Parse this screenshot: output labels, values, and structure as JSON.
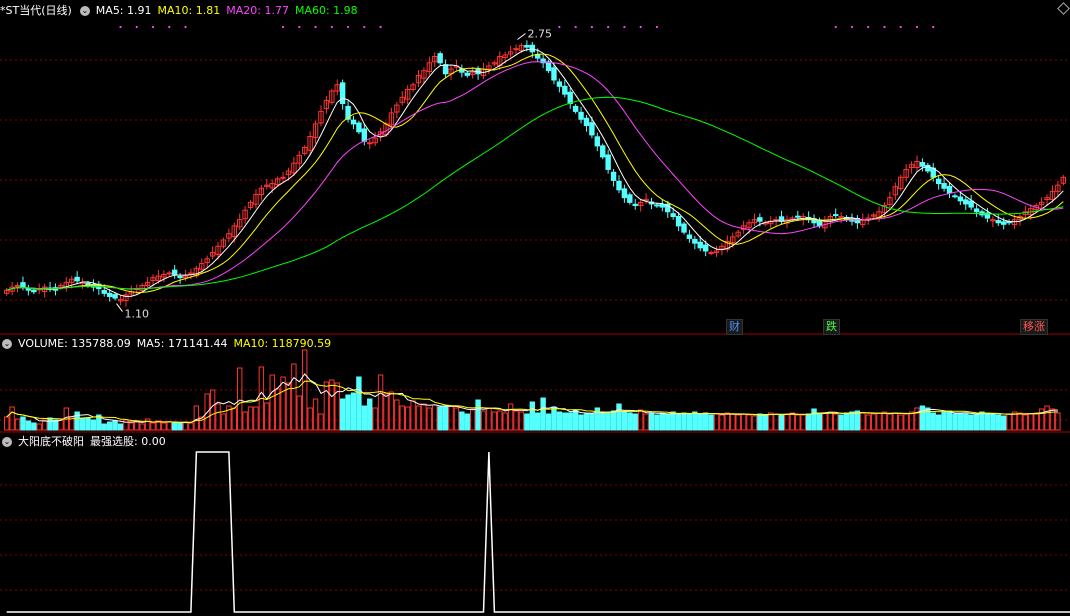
{
  "header": {
    "title": "*ST当代(日线)",
    "ma": [
      {
        "label": "MA5: 1.91",
        "color": "#ffffff"
      },
      {
        "label": "MA10: 1.81",
        "color": "#ffff00"
      },
      {
        "label": "MA20: 1.77",
        "color": "#ff44ff"
      },
      {
        "label": "MA60: 1.98",
        "color": "#00ff00"
      }
    ]
  },
  "volume_header": {
    "label": "VOLUME: 135788.09",
    "ma5": "MA5: 171141.44",
    "ma10": "MA10: 118790.59"
  },
  "indicator_header": {
    "label": "大阳底不破阳",
    "sub": "最强选股: 0.00"
  },
  "tags": [
    {
      "text": "财",
      "color": "#4a90ff"
    },
    {
      "text": "跌",
      "color": "#44ff44"
    },
    {
      "text": "移涨",
      "color": "#ff5555"
    }
  ],
  "annotations": {
    "high": "2.75",
    "low": "1.10"
  },
  "colors": {
    "up": "#ff3232",
    "down": "#54ffff",
    "grid": "#8b0000"
  },
  "chart_data": {
    "type": "candlestick",
    "x": [
      0,
      1,
      2,
      3,
      4,
      5,
      6,
      7,
      8,
      9,
      10,
      11,
      12,
      13,
      14,
      15,
      16,
      17,
      18,
      19,
      20,
      21,
      22,
      23,
      24,
      25,
      26,
      27,
      28,
      29,
      30,
      31,
      32,
      33,
      34,
      35,
      36,
      37,
      38,
      39,
      40,
      41,
      42,
      43,
      44,
      45,
      46,
      47,
      48,
      49,
      50,
      51,
      52,
      53,
      54,
      55,
      56,
      57,
      58,
      59,
      60,
      61,
      62,
      63,
      64,
      65,
      66,
      67,
      68,
      69,
      70,
      71,
      72,
      73,
      74,
      75,
      76,
      77,
      78,
      79,
      80,
      81,
      82,
      83,
      84,
      85,
      86,
      87,
      88,
      89,
      90,
      91,
      92,
      93,
      94,
      95,
      96,
      97,
      98,
      99,
      100,
      101,
      102,
      103,
      104,
      105,
      106,
      107,
      108,
      109,
      110,
      111,
      112,
      113,
      114,
      115,
      116,
      117,
      118,
      119,
      120,
      121,
      122,
      123,
      124,
      125,
      126,
      127,
      128,
      129,
      130,
      131,
      132,
      133,
      134,
      135,
      136,
      137,
      138,
      139,
      140,
      141,
      142,
      143,
      144,
      145,
      146,
      147,
      148,
      149,
      150,
      151,
      152,
      153,
      154,
      155,
      156,
      157,
      158,
      159,
      160,
      161,
      162,
      163,
      164,
      165,
      166,
      167,
      168,
      169,
      170,
      171,
      172,
      173,
      174,
      175,
      176,
      177,
      178,
      179,
      180,
      181,
      182,
      183,
      184,
      185,
      186,
      187,
      188,
      189,
      190,
      191,
      192,
      193,
      194,
      195,
      196,
      197,
      198,
      199
    ],
    "close": [
      1.19,
      1.21,
      1.22,
      1.21,
      1.19,
      1.18,
      1.2,
      1.21,
      1.2,
      1.19,
      1.22,
      1.24,
      1.26,
      1.25,
      1.24,
      1.22,
      1.21,
      1.2,
      1.17,
      1.15,
      1.14,
      1.13,
      1.16,
      1.18,
      1.2,
      1.22,
      1.24,
      1.27,
      1.28,
      1.29,
      1.3,
      1.29,
      1.27,
      1.28,
      1.3,
      1.33,
      1.36,
      1.39,
      1.43,
      1.47,
      1.51,
      1.55,
      1.6,
      1.64,
      1.7,
      1.75,
      1.8,
      1.84,
      1.86,
      1.87,
      1.9,
      1.91,
      1.95,
      2.0,
      2.05,
      2.1,
      2.17,
      2.25,
      2.33,
      2.4,
      2.46,
      2.5,
      2.38,
      2.28,
      2.25,
      2.2,
      2.14,
      2.13,
      2.16,
      2.2,
      2.25,
      2.32,
      2.37,
      2.42,
      2.47,
      2.5,
      2.56,
      2.59,
      2.64,
      2.68,
      2.64,
      2.57,
      2.6,
      2.62,
      2.58,
      2.56,
      2.58,
      2.57,
      2.6,
      2.62,
      2.64,
      2.68,
      2.69,
      2.71,
      2.73,
      2.75,
      2.74,
      2.71,
      2.67,
      2.64,
      2.59,
      2.53,
      2.49,
      2.44,
      2.38,
      2.33,
      2.28,
      2.24,
      2.18,
      2.11,
      2.04,
      1.96,
      1.89,
      1.83,
      1.78,
      1.75,
      1.73,
      1.75,
      1.77,
      1.74,
      1.73,
      1.72,
      1.69,
      1.66,
      1.6,
      1.56,
      1.52,
      1.49,
      1.46,
      1.44,
      1.43,
      1.44,
      1.47,
      1.5,
      1.53,
      1.56,
      1.6,
      1.62,
      1.64,
      1.63,
      1.62,
      1.63,
      1.64,
      1.63,
      1.64,
      1.65,
      1.66,
      1.66,
      1.64,
      1.62,
      1.6,
      1.63,
      1.66,
      1.67,
      1.66,
      1.64,
      1.63,
      1.62,
      1.64,
      1.65,
      1.67,
      1.69,
      1.73,
      1.78,
      1.85,
      1.91,
      1.96,
      1.99,
      2.01,
      1.98,
      1.95,
      1.91,
      1.87,
      1.84,
      1.81,
      1.79,
      1.76,
      1.74,
      1.72,
      1.69,
      1.67,
      1.65,
      1.64,
      1.62,
      1.61,
      1.62,
      1.64,
      1.66,
      1.69,
      1.71,
      1.73,
      1.75,
      1.78,
      1.82,
      1.86,
      1.91
    ],
    "volume": [
      1.3,
      2.3,
      1.1,
      1.3,
      0.9,
      0.7,
      0.6,
      1.0,
      1.2,
      1.0,
      1.0,
      2.2,
      1.3,
      1.8,
      1.2,
      1.2,
      1.0,
      1.5,
      0.6,
      0.8,
      0.9,
      0.6,
      1.0,
      0.7,
      0.9,
      0.6,
      1.1,
      0.7,
      0.9,
      0.7,
      0.8,
      0.7,
      0.7,
      0.8,
      0.7,
      2.4,
      1.3,
      3.6,
      4.0,
      2.6,
      1.6,
      2.4,
      2.2,
      6.2,
      1.8,
      2.3,
      2.3,
      6.3,
      2.7,
      5.5,
      4.1,
      5.3,
      4.7,
      6.6,
      3.4,
      8.0,
      2.2,
      3.1,
      1.6,
      4.8,
      5.0,
      4.7,
      3.1,
      3.5,
      3.7,
      5.3,
      2.4,
      3.1,
      2.2,
      5.5,
      3.6,
      3.8,
      3.0,
      2.4,
      2.3,
      2.9,
      2.4,
      2.6,
      2.2,
      2.5,
      2.3,
      2.4,
      2.4,
      2.2,
      1.8,
      1.6,
      2.1,
      3.0,
      1.9,
      2.2,
      1.8,
      1.9,
      1.7,
      2.6,
      1.9,
      1.8,
      1.6,
      2.8,
      1.7,
      3.2,
      1.6,
      2.3,
      1.8,
      1.7,
      1.7,
      2.0,
      1.5,
      1.6,
      1.6,
      2.2,
      1.7,
      1.8,
      1.9,
      2.6,
      1.8,
      1.7,
      1.6,
      2.0,
      1.6,
      1.7,
      1.5,
      1.6,
      1.6,
      1.8,
      1.5,
      1.7,
      1.6,
      1.8,
      1.6,
      1.7,
      1.5,
      1.6,
      1.5,
      1.7,
      1.6,
      1.5,
      1.6,
      1.5,
      1.4,
      1.6,
      1.5,
      1.7,
      1.6,
      1.5,
      1.6,
      1.7,
      1.5,
      1.5,
      1.6,
      2.1,
      1.7,
      1.7,
      1.8,
      1.6,
      1.5,
      1.7,
      1.8,
      1.9,
      1.7,
      1.5,
      1.6,
      1.7,
      1.8,
      1.6,
      1.7,
      1.5,
      1.6,
      1.8,
      2.2,
      2.4,
      2.2,
      1.7,
      1.5,
      1.8,
      1.9,
      1.6,
      1.7,
      1.6,
      1.5,
      1.6,
      1.8,
      1.7,
      1.6,
      1.5,
      1.4,
      1.6,
      1.8,
      1.7,
      1.5,
      1.6,
      1.7,
      2.1,
      2.4,
      2.1,
      1.7
    ],
    "signal": [
      0,
      0,
      0,
      0,
      0,
      0,
      0,
      0,
      0,
      0,
      0,
      0,
      0,
      0,
      0,
      0,
      0,
      0,
      0,
      0,
      0,
      0,
      0,
      0,
      0,
      0,
      0,
      0,
      0,
      0,
      0,
      0,
      0,
      0,
      0,
      1,
      1,
      1,
      1,
      1,
      1,
      1,
      0,
      0,
      0,
      0,
      0,
      0,
      0,
      0,
      0,
      0,
      0,
      0,
      0,
      0,
      0,
      0,
      0,
      0,
      0,
      0,
      0,
      0,
      0,
      0,
      0,
      0,
      0,
      0,
      0,
      0,
      0,
      0,
      0,
      0,
      0,
      0,
      0,
      0,
      0,
      0,
      0,
      0,
      0,
      0,
      0,
      0,
      0,
      1,
      0,
      0,
      0,
      0,
      0,
      0,
      0,
      0,
      0,
      0,
      0,
      0,
      0,
      0,
      0,
      0,
      0,
      0,
      0,
      0,
      0,
      0,
      0,
      0,
      0,
      0,
      0,
      0,
      0,
      0,
      0,
      0,
      0,
      0,
      0,
      0,
      0,
      0,
      0,
      0,
      0,
      0,
      0,
      0,
      0,
      0,
      0,
      0,
      0,
      0,
      0,
      0,
      0,
      0,
      0,
      0,
      0,
      0,
      0,
      0,
      0,
      0,
      0,
      0,
      0,
      0,
      0,
      0,
      0,
      0,
      0,
      0,
      0,
      0,
      0,
      0,
      0,
      0,
      0,
      0,
      0,
      0,
      0,
      0,
      0,
      0,
      0,
      0,
      0,
      0,
      0,
      0,
      0,
      0,
      0,
      0,
      0,
      0,
      0,
      0,
      0,
      0,
      0,
      0,
      0,
      0,
      0,
      0,
      0,
      0,
      0
    ],
    "ylim": [
      1.0,
      2.9
    ]
  }
}
